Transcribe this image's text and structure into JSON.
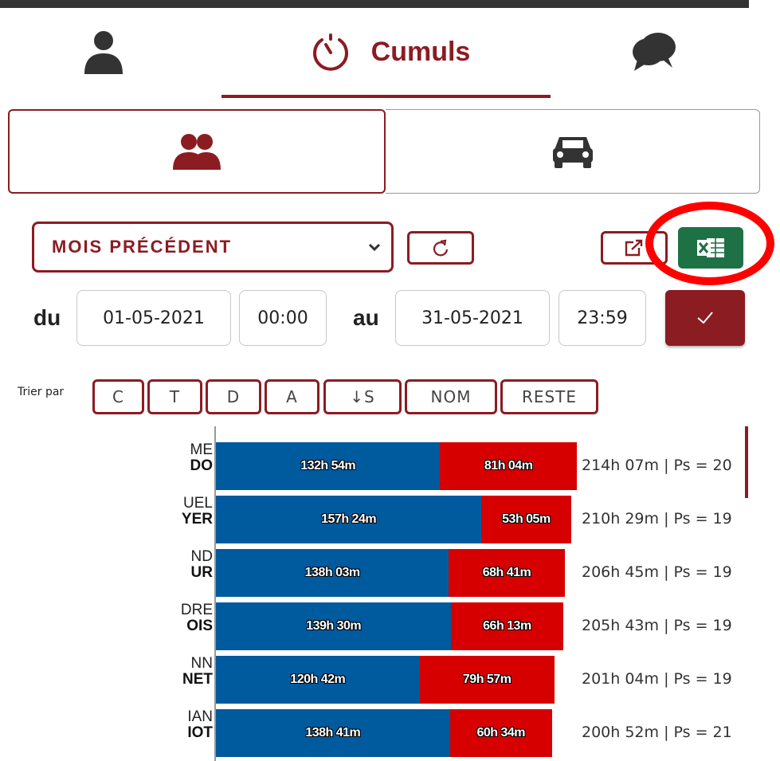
{
  "tabs": {
    "person_icon": "user-icon",
    "cumuls_label": "Cumuls",
    "cumuls_icon": "stopwatch-icon",
    "chat_icon": "chat-icon"
  },
  "subtabs": {
    "group_icon": "users-icon",
    "car_icon": "car-icon"
  },
  "filters": {
    "period_selected": "MOIS PRÉCÉDENT",
    "refresh_icon": "refresh-icon",
    "export_icon": "external-link-icon",
    "excel_icon": "excel-icon",
    "from_label": "du",
    "from_date": "01-05-2021",
    "from_time": "00:00",
    "to_label": "au",
    "to_date": "31-05-2021",
    "to_time": "23:59",
    "validate_icon": "check-icon"
  },
  "sort": {
    "label": "Trier par",
    "buttons": [
      "C",
      "T",
      "D",
      "A",
      "↓S",
      "NOM",
      "RESTE"
    ]
  },
  "colors": {
    "accent": "#8b1c22",
    "excel": "#1e7045",
    "bar_primary": "#005a9e",
    "bar_secondary": "#d60000",
    "highlight": "#ff0000"
  },
  "chart_data": {
    "type": "bar",
    "orientation": "horizontal",
    "stacked": true,
    "rows": [
      {
        "first": "ME",
        "last": "DO",
        "blue": "132h 54m",
        "red": "81h 04m",
        "blue_minutes": 7974,
        "red_minutes": 4864,
        "total": "214h 07m | Ps = 20"
      },
      {
        "first": "UEL",
        "last": "YER",
        "blue": "157h 24m",
        "red": "53h 05m",
        "blue_minutes": 9444,
        "red_minutes": 3185,
        "total": "210h 29m | Ps = 19"
      },
      {
        "first": "ND",
        "last": "UR",
        "blue": "138h 03m",
        "red": "68h 41m",
        "blue_minutes": 8283,
        "red_minutes": 4121,
        "total": "206h 45m | Ps = 19"
      },
      {
        "first": "DRE",
        "last": "OIS",
        "blue": "139h 30m",
        "red": "66h 13m",
        "blue_minutes": 8370,
        "red_minutes": 3973,
        "total": "205h 43m | Ps = 19"
      },
      {
        "first": "NN",
        "last": "NET",
        "blue": "120h 42m",
        "red": "79h 57m",
        "blue_minutes": 7242,
        "red_minutes": 4797,
        "total": "201h 04m | Ps = 19"
      },
      {
        "first": "IAN",
        "last": "IOT",
        "blue": "138h 41m",
        "red": "60h 34m",
        "blue_minutes": 8321,
        "red_minutes": 3634,
        "total": "200h 52m | Ps = 21"
      }
    ]
  }
}
